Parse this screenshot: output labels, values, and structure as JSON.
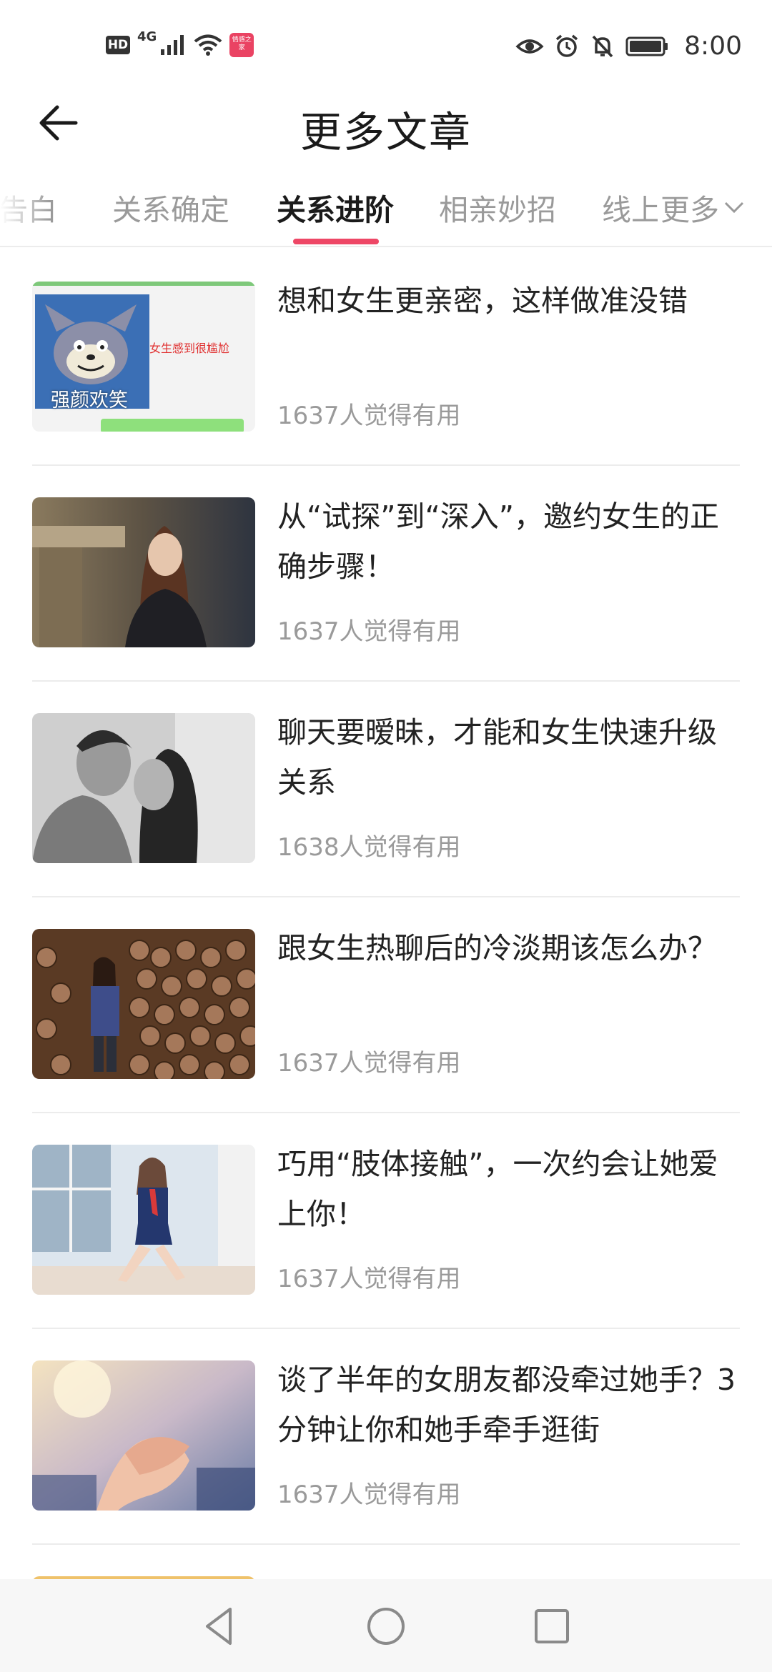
{
  "status_bar": {
    "hd": "HD",
    "network": "4G",
    "app_badge": "情感之家",
    "time": "8:00"
  },
  "header": {
    "title": "更多文章",
    "back_icon": "back-arrow-icon"
  },
  "tabs": {
    "items": [
      {
        "label": "告白"
      },
      {
        "label": "关系确定"
      },
      {
        "label": "关系进阶"
      },
      {
        "label": "相亲妙招"
      },
      {
        "label": "线上"
      }
    ],
    "active_index": 2,
    "more_label": "更多",
    "accent": "#ee4766"
  },
  "articles": [
    {
      "title": "想和女生更亲密，这样做准没错",
      "meta": "1637人觉得有用",
      "thumb_text": "强颜欢笑",
      "thumb_caption": "女生感到很尴尬"
    },
    {
      "title": "从“试探”到“深入”，邀约女生的正确步骤！",
      "meta": "1637人觉得有用"
    },
    {
      "title": "聊天要暧昧，才能和女生快速升级关系",
      "meta": "1638人觉得有用"
    },
    {
      "title": "跟女生热聊后的冷淡期该怎么办？",
      "meta": "1637人觉得有用"
    },
    {
      "title": "巧用“肢体接触”，一次约会让她爱上你！",
      "meta": "1637人觉得有用"
    },
    {
      "title": "谈了半年的女朋友都没牵过她手？3分钟让你和她手牵手逛街",
      "meta": "1637人觉得有用"
    }
  ],
  "nav_bar": {
    "back": "nav-back-icon",
    "home": "nav-home-icon",
    "recents": "nav-recents-icon"
  }
}
